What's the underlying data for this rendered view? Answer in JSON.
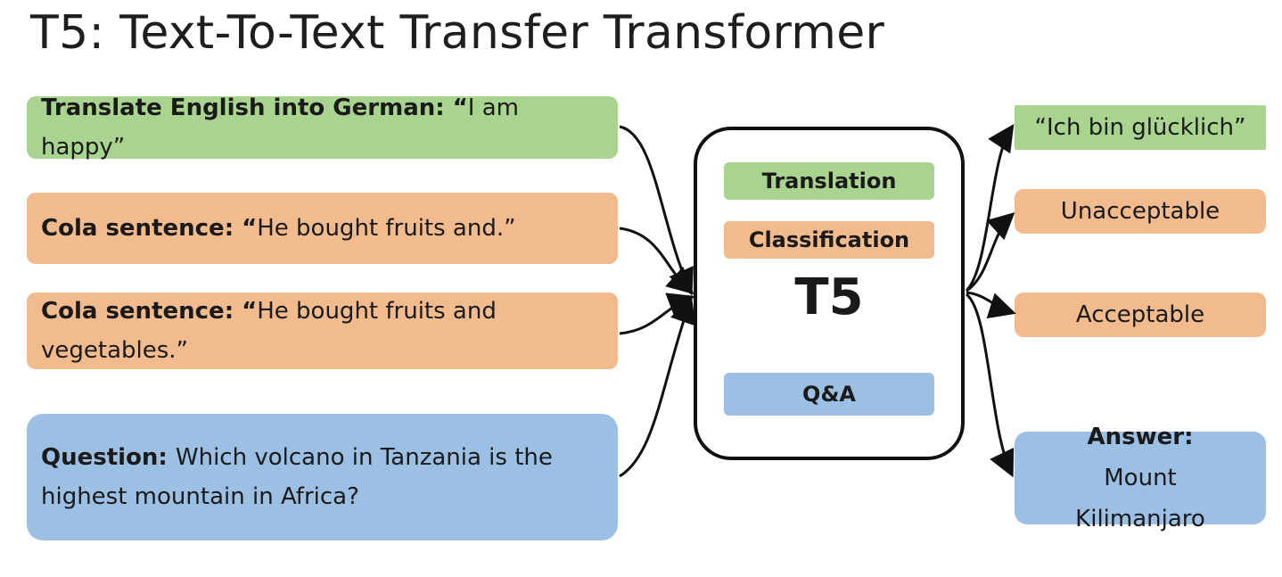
{
  "title": "T5: Text-To-Text Transfer Transformer",
  "inputs": [
    {
      "bold": "Translate English into German: “",
      "text": "I am happy”",
      "color": "green"
    },
    {
      "bold": "Cola sentence: “",
      "text": "He bought fruits and.”",
      "color": "orange"
    },
    {
      "bold": "Cola sentence: “",
      "text": "He bought fruits and vegetables.”",
      "color": "orange"
    },
    {
      "bold": "Question: ",
      "text": "Which volcano in Tanzania is the highest mountain in Africa?",
      "color": "blue"
    }
  ],
  "model": {
    "name": "T5",
    "tasks": [
      "Translation",
      "Classification",
      "Q&A"
    ]
  },
  "outputs": [
    {
      "bold": "",
      "text": "“Ich bin glücklich”",
      "color": "green"
    },
    {
      "bold": "",
      "text": "Unacceptable",
      "color": "orange"
    },
    {
      "bold": "",
      "text": "Acceptable",
      "color": "orange"
    },
    {
      "bold": "Answer: ",
      "text": "Mount Kilimanjaro",
      "color": "blue"
    }
  ],
  "colors": {
    "green": "#a9d48f",
    "orange": "#f2bb8e",
    "blue": "#9cbfe4",
    "arrow": "#111111"
  }
}
